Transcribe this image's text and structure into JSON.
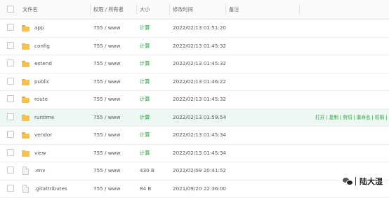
{
  "header": {
    "name": "文件名",
    "permission": "权限 / 所有者",
    "size": "大小",
    "modified": "修改时间",
    "remark": "备注"
  },
  "rows": [
    {
      "type": "folder",
      "name": "app",
      "perm": "755 / www",
      "size": "计算",
      "time": "2022/02/13 01:51:20"
    },
    {
      "type": "folder",
      "name": "config",
      "perm": "755 / www",
      "size": "计算",
      "time": "2022/02/13 01:45:32"
    },
    {
      "type": "folder",
      "name": "extend",
      "perm": "755 / www",
      "size": "计算",
      "time": "2022/02/13 01:45:32"
    },
    {
      "type": "folder",
      "name": "public",
      "perm": "755 / www",
      "size": "计算",
      "time": "2022/02/13 01:46:22"
    },
    {
      "type": "folder",
      "name": "route",
      "perm": "755 / www",
      "size": "计算",
      "time": "2022/02/13 01:45:32"
    },
    {
      "type": "folder",
      "name": "runtime",
      "perm": "755 / www",
      "size": "计算",
      "time": "2022/02/13 01:59:54"
    },
    {
      "type": "folder",
      "name": "vendor",
      "perm": "755 / www",
      "size": "计算",
      "time": "2022/02/13 01:45:34"
    },
    {
      "type": "folder",
      "name": "view",
      "perm": "755 / www",
      "size": "计算",
      "time": "2022/02/13 01:45:34"
    },
    {
      "type": "file",
      "name": ".env",
      "perm": "755 / www",
      "size": "430 B",
      "time": "2022/02/09 20:41:52"
    },
    {
      "type": "file",
      "name": ".gitattributes",
      "perm": "755 / www",
      "size": "84 B",
      "time": "2021/09/20 22:36:00"
    }
  ],
  "row_actions": "打开 | 复制 | 剪切 | 重命名 | 权限 | 压",
  "watermark": "陆大湿",
  "colors": {
    "accent": "#20a53a",
    "highlight": "#eef8f2",
    "folder": "#f6c24a"
  }
}
